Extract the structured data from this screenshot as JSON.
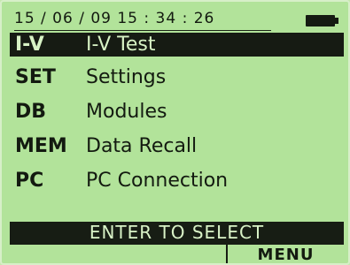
{
  "status": {
    "datetime": "15 / 06 / 09   15 : 34 : 26",
    "battery_icon": "battery-icon"
  },
  "menu": {
    "items": [
      {
        "code": "I-V",
        "label": "I-V Test",
        "selected": true
      },
      {
        "code": "SET",
        "label": "Settings",
        "selected": false
      },
      {
        "code": "DB",
        "label": "Modules",
        "selected": false
      },
      {
        "code": "MEM",
        "label": "Data Recall",
        "selected": false
      },
      {
        "code": "PC",
        "label": "PC Connection",
        "selected": false
      }
    ]
  },
  "footer": {
    "instruction": "ENTER TO SELECT",
    "softkey_menu": "MENU"
  },
  "colors": {
    "screen_background": "#b2e39a",
    "text": "#131a10",
    "selection_background": "#161b13",
    "selection_text": "#d8f3c5"
  }
}
